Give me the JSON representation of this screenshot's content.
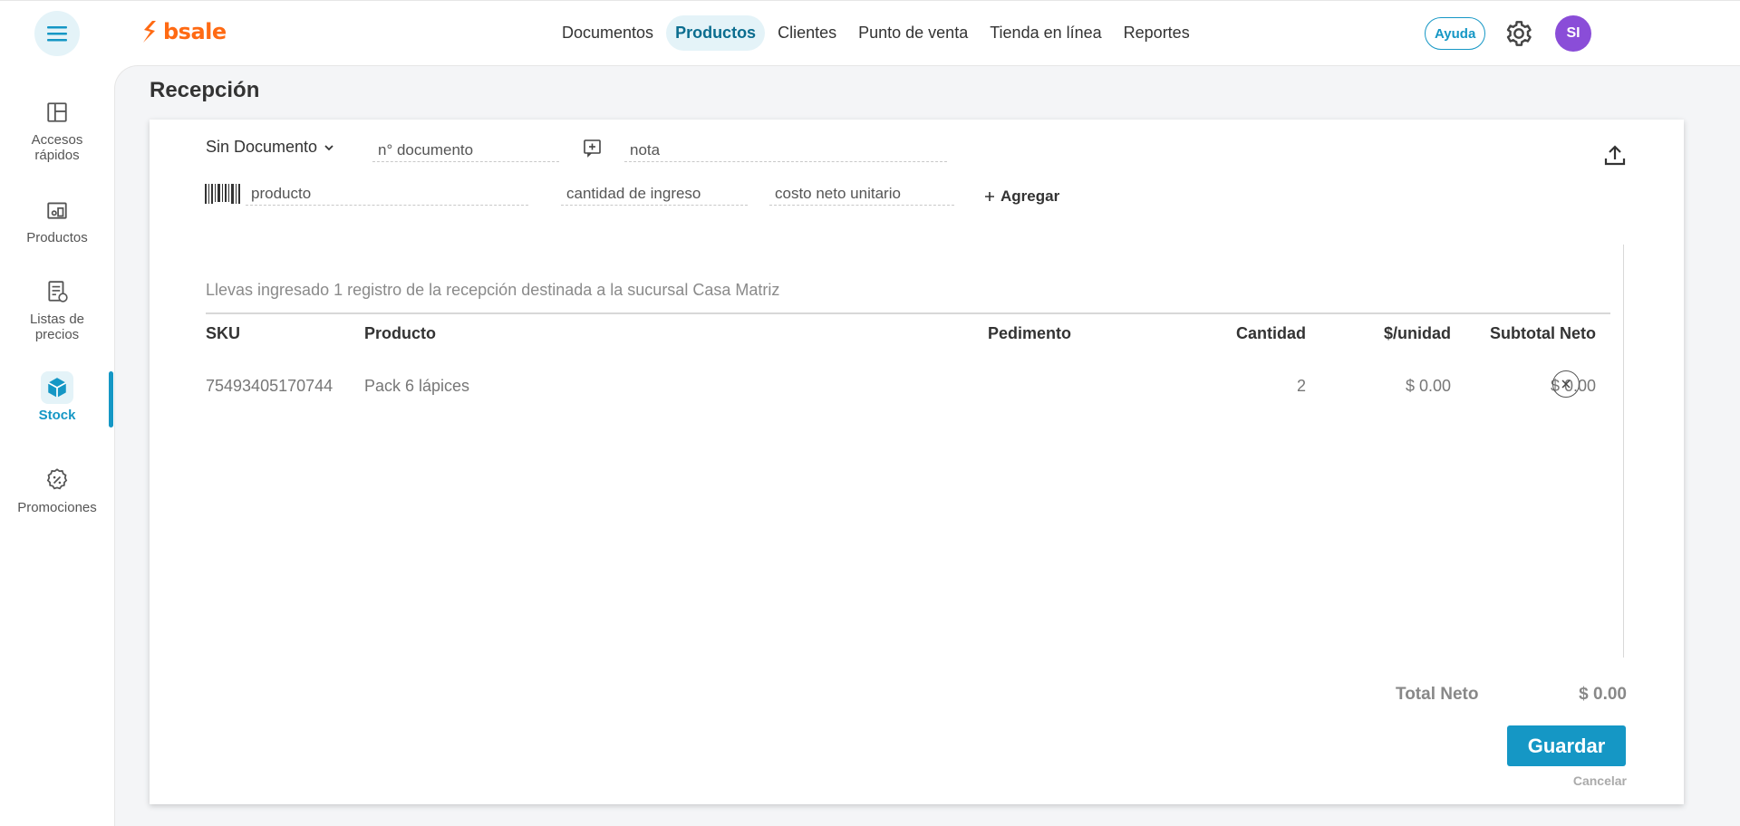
{
  "brand": {
    "name": "bsale",
    "accent": "#1597c5",
    "logo_color": "#ff6a13"
  },
  "nav": {
    "items": [
      {
        "label": "Documentos"
      },
      {
        "label": "Productos"
      },
      {
        "label": "Clientes"
      },
      {
        "label": "Punto de venta"
      },
      {
        "label": "Tienda en línea"
      },
      {
        "label": "Reportes"
      }
    ],
    "active": "Productos",
    "help_label": "Ayuda",
    "avatar_initials": "SI",
    "avatar_color": "#8a4dd8"
  },
  "sidebar": {
    "items": [
      {
        "label": "Accesos rápidos",
        "icon": "layout-icon"
      },
      {
        "label": "Productos",
        "icon": "products-icon"
      },
      {
        "label": "Listas de precios",
        "icon": "price-list-icon"
      },
      {
        "label": "Stock",
        "icon": "box-icon",
        "active": true
      },
      {
        "label": "Promociones",
        "icon": "promo-icon"
      }
    ]
  },
  "page": {
    "title": "Recepción"
  },
  "form": {
    "document_type": "Sin Documento",
    "doc_number_placeholder": "n° documento",
    "note_placeholder": "nota",
    "product_placeholder": "producto",
    "quantity_placeholder": "cantidad de ingreso",
    "cost_placeholder": "costo neto unitario",
    "add_label": "Agregar"
  },
  "summary": "Llevas ingresado 1 registro de la recepción destinada a la sucursal Casa Matriz",
  "table": {
    "headers": [
      "SKU",
      "Producto",
      "Pedimento",
      "Cantidad",
      "$/unidad",
      "Subtotal Neto"
    ],
    "rows": [
      {
        "sku": "75493405170744",
        "product": "Pack 6 lápices",
        "pedimento": "",
        "quantity": "2",
        "unit_price": "$ 0.00",
        "subtotal": "$ 0.00"
      }
    ]
  },
  "totals": {
    "label": "Total Neto",
    "value": "$ 0.00"
  },
  "actions": {
    "save_label": "Guardar",
    "cancel_label": "Cancelar"
  }
}
